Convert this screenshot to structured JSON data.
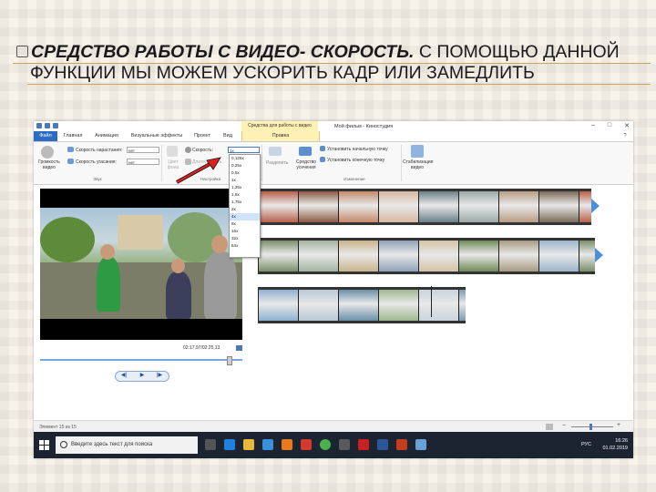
{
  "slide": {
    "heading_bold": "СРЕДСТВО РАБОТЫ С ВИДЕО- СКОРОСТЬ.",
    "heading_rest": " С ПОМОЩЬЮ ДАННОЙ",
    "line2": "ФУНКЦИИ МЫ МОЖЕМ УСКОРИТЬ КАДР ИЛИ ЗАМЕДЛИТЬ"
  },
  "window": {
    "tool_tab": "Средства для работы с видео",
    "title": "Мой фильм - Киностудия",
    "minimize": "–",
    "maximize": "□",
    "close": "✕"
  },
  "tabs": [
    "Файл",
    "Главная",
    "Анимация",
    "Визуальные эффекты",
    "Проект",
    "Вид",
    "Правка"
  ],
  "ribbon": {
    "volume_label": "Громкость видео",
    "fade_in_label": "Скорость нарастания:",
    "fade_out_label": "Скорость угасания:",
    "fade_in_value": "нет",
    "fade_out_value": "нет",
    "bg_color_label": "Цвет фона",
    "speed_label": "Скорость:",
    "speed_value": "1x",
    "duration_label": "Длительность:",
    "split_label": "Разделить",
    "trim_label": "Средство усечения",
    "set_start_label": "Установить начальную точку",
    "set_end_label": "Установить конечную точку",
    "stabilize_label": "Стабилизация видео",
    "group_audio": "Звук",
    "group_settings": "Настройка",
    "group_editing": "Изменение"
  },
  "speed_options": [
    "0,125x",
    "0,25x",
    "0,5x",
    "1x",
    "1,25x",
    "1,5x",
    "1,75x",
    "2x",
    "4x",
    "8x",
    "16x",
    "32x",
    "64x"
  ],
  "speed_selected": "4x",
  "preview": {
    "timecode": "02:17,97/02:25,13",
    "position_fraction": 0.94
  },
  "status": {
    "item_text": "Элемент 15 из 15"
  },
  "taskbar": {
    "search_placeholder": "Введите здесь текст для поиска",
    "language": "РУС",
    "time": "16:26",
    "date": "01.02.2019"
  },
  "colors": {
    "accent": "#2b6cc4",
    "video_tools_tab": "#fff0b3",
    "arrow": "#e02020",
    "taskbar": "#1c2432"
  }
}
